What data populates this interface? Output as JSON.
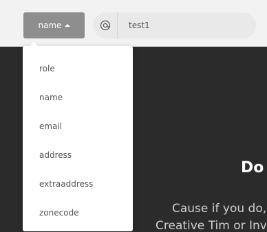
{
  "toolbar": {
    "dropdown_label": "name",
    "search_value": "test1"
  },
  "menu": {
    "items": [
      {
        "label": "role"
      },
      {
        "label": "name"
      },
      {
        "label": "email"
      },
      {
        "label": "address"
      },
      {
        "label": "extraaddress"
      },
      {
        "label": "zonecode"
      }
    ]
  },
  "hero": {
    "title_partial": "Do",
    "line1_partial": "Cause if you do,",
    "line2_partial": "Creative Tim or Inv"
  },
  "icons": {
    "dropdown_caret": "caret-up-icon",
    "search_field": "at-sign-icon"
  },
  "colors": {
    "toolbar_bg": "#f2f2f2",
    "button_bg": "#8e8e8e",
    "page_bg": "#2b2b2b"
  }
}
